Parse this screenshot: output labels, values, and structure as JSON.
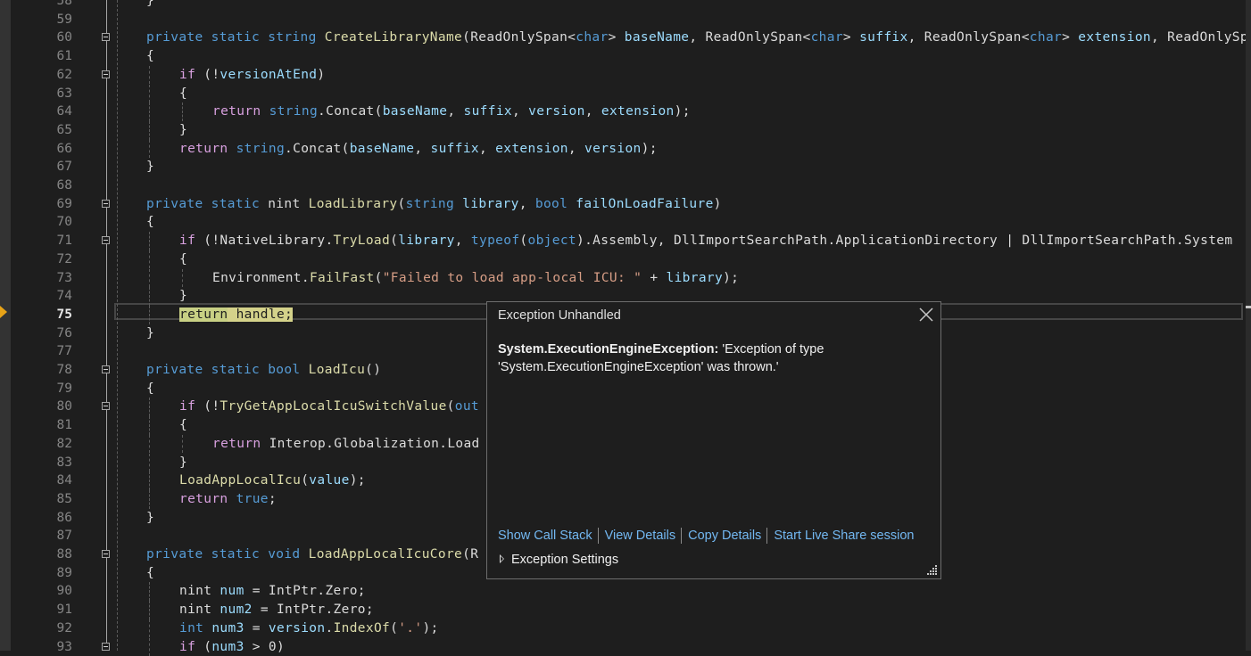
{
  "editor": {
    "current_line": 75,
    "lines": [
      {
        "n": "58",
        "indent": 0,
        "tokens": [
          {
            "c": "",
            "t": "}"
          }
        ]
      },
      {
        "n": "59",
        "indent": 0,
        "tokens": []
      },
      {
        "n": "60",
        "indent": 0,
        "fold": true,
        "tokens": [
          {
            "c": "k",
            "t": "private static string "
          },
          {
            "c": "m",
            "t": "CreateLibraryName"
          },
          {
            "c": "",
            "t": "(ReadOnlySpan<"
          },
          {
            "c": "k",
            "t": "char"
          },
          {
            "c": "",
            "t": "> "
          },
          {
            "c": "p",
            "t": "baseName"
          },
          {
            "c": "",
            "t": ", ReadOnlySpan<"
          },
          {
            "c": "k",
            "t": "char"
          },
          {
            "c": "",
            "t": "> "
          },
          {
            "c": "p",
            "t": "suffix"
          },
          {
            "c": "",
            "t": ", ReadOnlySpan<"
          },
          {
            "c": "k",
            "t": "char"
          },
          {
            "c": "",
            "t": "> "
          },
          {
            "c": "p",
            "t": "extension"
          },
          {
            "c": "",
            "t": ", ReadOnlySpan<"
          }
        ]
      },
      {
        "n": "61",
        "indent": 0,
        "tokens": [
          {
            "c": "",
            "t": "{"
          }
        ]
      },
      {
        "n": "62",
        "indent": 1,
        "fold": true,
        "tokens": [
          {
            "c": "c",
            "t": "if"
          },
          {
            "c": "",
            "t": " (!"
          },
          {
            "c": "p",
            "t": "versionAtEnd"
          },
          {
            "c": "",
            "t": ")"
          }
        ]
      },
      {
        "n": "63",
        "indent": 1,
        "tokens": [
          {
            "c": "",
            "t": "{"
          }
        ]
      },
      {
        "n": "64",
        "indent": 2,
        "tokens": [
          {
            "c": "c",
            "t": "return "
          },
          {
            "c": "k",
            "t": "string"
          },
          {
            "c": "",
            "t": ".Concat("
          },
          {
            "c": "p",
            "t": "baseName"
          },
          {
            "c": "",
            "t": ", "
          },
          {
            "c": "p",
            "t": "suffix"
          },
          {
            "c": "",
            "t": ", "
          },
          {
            "c": "p",
            "t": "version"
          },
          {
            "c": "",
            "t": ", "
          },
          {
            "c": "p",
            "t": "extension"
          },
          {
            "c": "",
            "t": ");"
          }
        ]
      },
      {
        "n": "65",
        "indent": 1,
        "tokens": [
          {
            "c": "",
            "t": "}"
          }
        ]
      },
      {
        "n": "66",
        "indent": 1,
        "tokens": [
          {
            "c": "c",
            "t": "return "
          },
          {
            "c": "k",
            "t": "string"
          },
          {
            "c": "",
            "t": ".Concat("
          },
          {
            "c": "p",
            "t": "baseName"
          },
          {
            "c": "",
            "t": ", "
          },
          {
            "c": "p",
            "t": "suffix"
          },
          {
            "c": "",
            "t": ", "
          },
          {
            "c": "p",
            "t": "extension"
          },
          {
            "c": "",
            "t": ", "
          },
          {
            "c": "p",
            "t": "version"
          },
          {
            "c": "",
            "t": ");"
          }
        ]
      },
      {
        "n": "67",
        "indent": 0,
        "tokens": [
          {
            "c": "",
            "t": "}"
          }
        ]
      },
      {
        "n": "68",
        "indent": 0,
        "tokens": []
      },
      {
        "n": "69",
        "indent": 0,
        "fold": true,
        "tokens": [
          {
            "c": "k",
            "t": "private static "
          },
          {
            "c": "",
            "t": "nint "
          },
          {
            "c": "m",
            "t": "LoadLibrary"
          },
          {
            "c": "",
            "t": "("
          },
          {
            "c": "k",
            "t": "string "
          },
          {
            "c": "p",
            "t": "library"
          },
          {
            "c": "",
            "t": ", "
          },
          {
            "c": "k",
            "t": "bool "
          },
          {
            "c": "p",
            "t": "failOnLoadFailure"
          },
          {
            "c": "",
            "t": ")"
          }
        ]
      },
      {
        "n": "70",
        "indent": 0,
        "tokens": [
          {
            "c": "",
            "t": "{"
          }
        ]
      },
      {
        "n": "71",
        "indent": 1,
        "fold": true,
        "tokens": [
          {
            "c": "c",
            "t": "if"
          },
          {
            "c": "",
            "t": " (!NativeLibrary."
          },
          {
            "c": "m",
            "t": "TryLoad"
          },
          {
            "c": "",
            "t": "("
          },
          {
            "c": "p",
            "t": "library"
          },
          {
            "c": "",
            "t": ", "
          },
          {
            "c": "k",
            "t": "typeof"
          },
          {
            "c": "",
            "t": "("
          },
          {
            "c": "k",
            "t": "object"
          },
          {
            "c": "",
            "t": ").Assembly, DllImportSearchPath.ApplicationDirectory | DllImportSearchPath.System"
          }
        ]
      },
      {
        "n": "72",
        "indent": 1,
        "tokens": [
          {
            "c": "",
            "t": "{"
          }
        ]
      },
      {
        "n": "73",
        "indent": 2,
        "tokens": [
          {
            "c": "",
            "t": "Environment."
          },
          {
            "c": "m",
            "t": "FailFast"
          },
          {
            "c": "",
            "t": "("
          },
          {
            "c": "s",
            "t": "\"Failed to load app-local ICU: \""
          },
          {
            "c": "",
            "t": " + "
          },
          {
            "c": "p",
            "t": "library"
          },
          {
            "c": "",
            "t": ");"
          }
        ]
      },
      {
        "n": "74",
        "indent": 1,
        "tokens": [
          {
            "c": "",
            "t": "}"
          }
        ]
      },
      {
        "n": "75",
        "indent": 1,
        "current": true,
        "tokens": [
          {
            "c": "hl",
            "t": "return"
          },
          {
            "c": "hl2",
            "t": " handle;"
          }
        ]
      },
      {
        "n": "76",
        "indent": 0,
        "tokens": [
          {
            "c": "",
            "t": "}"
          }
        ]
      },
      {
        "n": "77",
        "indent": 0,
        "tokens": []
      },
      {
        "n": "78",
        "indent": 0,
        "fold": true,
        "tokens": [
          {
            "c": "k",
            "t": "private static bool "
          },
          {
            "c": "m",
            "t": "LoadIcu"
          },
          {
            "c": "",
            "t": "()"
          }
        ]
      },
      {
        "n": "79",
        "indent": 0,
        "tokens": [
          {
            "c": "",
            "t": "{"
          }
        ]
      },
      {
        "n": "80",
        "indent": 1,
        "fold": true,
        "tokens": [
          {
            "c": "c",
            "t": "if"
          },
          {
            "c": "",
            "t": " (!"
          },
          {
            "c": "m",
            "t": "TryGetAppLocalIcuSwitchValue"
          },
          {
            "c": "",
            "t": "("
          },
          {
            "c": "k",
            "t": "out"
          }
        ]
      },
      {
        "n": "81",
        "indent": 1,
        "tokens": [
          {
            "c": "",
            "t": "{"
          }
        ]
      },
      {
        "n": "82",
        "indent": 2,
        "tokens": [
          {
            "c": "c",
            "t": "return "
          },
          {
            "c": "",
            "t": "Interop.Globalization.Load"
          }
        ]
      },
      {
        "n": "83",
        "indent": 1,
        "tokens": [
          {
            "c": "",
            "t": "}"
          }
        ]
      },
      {
        "n": "84",
        "indent": 1,
        "tokens": [
          {
            "c": "m",
            "t": "LoadAppLocalIcu"
          },
          {
            "c": "",
            "t": "("
          },
          {
            "c": "p",
            "t": "value"
          },
          {
            "c": "",
            "t": ");"
          }
        ]
      },
      {
        "n": "85",
        "indent": 1,
        "tokens": [
          {
            "c": "c",
            "t": "return "
          },
          {
            "c": "k",
            "t": "true"
          },
          {
            "c": "",
            "t": ";"
          }
        ]
      },
      {
        "n": "86",
        "indent": 0,
        "tokens": [
          {
            "c": "",
            "t": "}"
          }
        ]
      },
      {
        "n": "87",
        "indent": 0,
        "tokens": []
      },
      {
        "n": "88",
        "indent": 0,
        "fold": true,
        "tokens": [
          {
            "c": "k",
            "t": "private static void "
          },
          {
            "c": "m",
            "t": "LoadAppLocalIcuCore"
          },
          {
            "c": "",
            "t": "(R"
          }
        ]
      },
      {
        "n": "89",
        "indent": 0,
        "tokens": [
          {
            "c": "",
            "t": "{"
          }
        ]
      },
      {
        "n": "90",
        "indent": 1,
        "tokens": [
          {
            "c": "",
            "t": "nint "
          },
          {
            "c": "p",
            "t": "num"
          },
          {
            "c": "",
            "t": " = IntPtr.Zero;"
          }
        ]
      },
      {
        "n": "91",
        "indent": 1,
        "tokens": [
          {
            "c": "",
            "t": "nint "
          },
          {
            "c": "p",
            "t": "num2"
          },
          {
            "c": "",
            "t": " = IntPtr.Zero;"
          }
        ]
      },
      {
        "n": "92",
        "indent": 1,
        "tokens": [
          {
            "c": "k",
            "t": "int "
          },
          {
            "c": "p",
            "t": "num3"
          },
          {
            "c": "",
            "t": " = "
          },
          {
            "c": "p",
            "t": "version"
          },
          {
            "c": "",
            "t": "."
          },
          {
            "c": "m",
            "t": "IndexOf"
          },
          {
            "c": "",
            "t": "("
          },
          {
            "c": "s",
            "t": "'.'"
          },
          {
            "c": "",
            "t": ");"
          }
        ]
      },
      {
        "n": "93",
        "indent": 1,
        "fold": true,
        "tokens": [
          {
            "c": "c",
            "t": "if"
          },
          {
            "c": "",
            "t": " ("
          },
          {
            "c": "p",
            "t": "num3"
          },
          {
            "c": "",
            "t": " > 0)"
          }
        ]
      }
    ]
  },
  "exception_popup": {
    "title": "Exception Unhandled",
    "exception_type": "System.ExecutionEngineException:",
    "message": " 'Exception of type 'System.ExecutionEngineException' was thrown.'",
    "links": {
      "show_call_stack": "Show Call Stack",
      "view_details": "View Details",
      "copy_details": "Copy Details",
      "live_share": "Start Live Share session"
    },
    "settings_label": "Exception Settings"
  },
  "icons": {
    "instruction_pointer": "instruction-pointer-arrow-icon",
    "close": "close-icon",
    "expand": "triangle-right-icon",
    "resize": "resize-grip-icon"
  }
}
